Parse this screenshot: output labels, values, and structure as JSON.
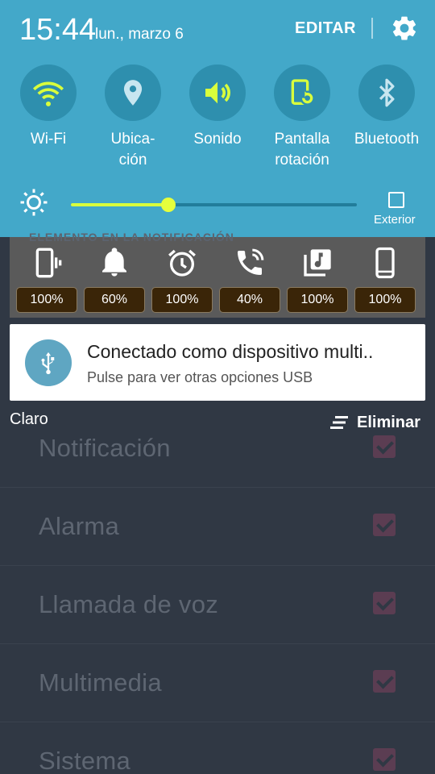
{
  "status": {
    "time": "15:44",
    "date": "lun., marzo 6"
  },
  "header": {
    "edit_label": "EDITAR",
    "settings_icon": "gear-icon"
  },
  "quick_toggles": [
    {
      "id": "wifi",
      "label": "Wi-Fi",
      "icon": "wifi-icon",
      "active": true
    },
    {
      "id": "location",
      "label": "Ubica-\nción",
      "icon": "location-pin-icon",
      "active": false
    },
    {
      "id": "sound",
      "label": "Sonido",
      "icon": "speaker-icon",
      "active": true
    },
    {
      "id": "rotation",
      "label": "Pantalla\nrotación",
      "icon": "screen-rotation-icon",
      "active": true
    },
    {
      "id": "bluetooth",
      "label": "Bluetooth",
      "icon": "bluetooth-icon",
      "active": false
    }
  ],
  "brightness": {
    "level": 0.34,
    "outdoor_label": "Exterior",
    "outdoor_checked": false
  },
  "volume_widget": {
    "title": "ELEMENTO EN LA NOTIFICACIÓN",
    "items": [
      {
        "icon": "phone-vibrate-icon",
        "value": "100%"
      },
      {
        "icon": "bell-icon",
        "value": "60%"
      },
      {
        "icon": "alarm-clock-icon",
        "value": "100%"
      },
      {
        "icon": "phone-ringing-icon",
        "value": "40%"
      },
      {
        "icon": "music-library-icon",
        "value": "100%"
      },
      {
        "icon": "smartphone-icon",
        "value": "100%"
      }
    ]
  },
  "usb_notification": {
    "title": "Conectado como dispositivo multi..",
    "subtitle": "Pulse para ver otras opciones USB",
    "icon": "usb-icon"
  },
  "footer": {
    "carrier": "Claro",
    "clear_label": "Eliminar"
  },
  "background_list": {
    "items": [
      "Notificación",
      "Alarma",
      "Llamada de voz",
      "Multimedia",
      "Sistema"
    ]
  },
  "colors": {
    "panel": "#43a8c9",
    "toggle_circle": "#2e8fae",
    "active_icon": "#d9ff3c",
    "background_app": "#303844"
  }
}
